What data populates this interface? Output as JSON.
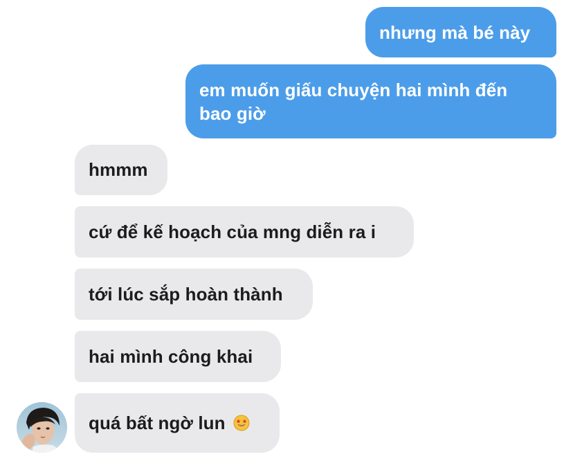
{
  "conversation": {
    "messages": [
      {
        "sender": "me",
        "text": "nhưng mà bé này"
      },
      {
        "sender": "me",
        "text": "em muốn giấu chuyện hai mình đến bao giờ"
      },
      {
        "sender": "them",
        "text": "hmmm"
      },
      {
        "sender": "them",
        "text": "cứ để kế hoạch của mng diễn ra i"
      },
      {
        "sender": "them",
        "text": "tới lúc sắp hoàn thành"
      },
      {
        "sender": "them",
        "text": "hai mình công khai"
      },
      {
        "sender": "them",
        "text": "quá bất ngờ lun",
        "emoji": "star-struck-emoji"
      }
    ]
  },
  "colors": {
    "sent_bubble": "#4c9de9",
    "received_bubble": "#e9e9ec",
    "text_dark": "#1c1c1e"
  },
  "avatar": {
    "icon": "contact-avatar-photo"
  }
}
